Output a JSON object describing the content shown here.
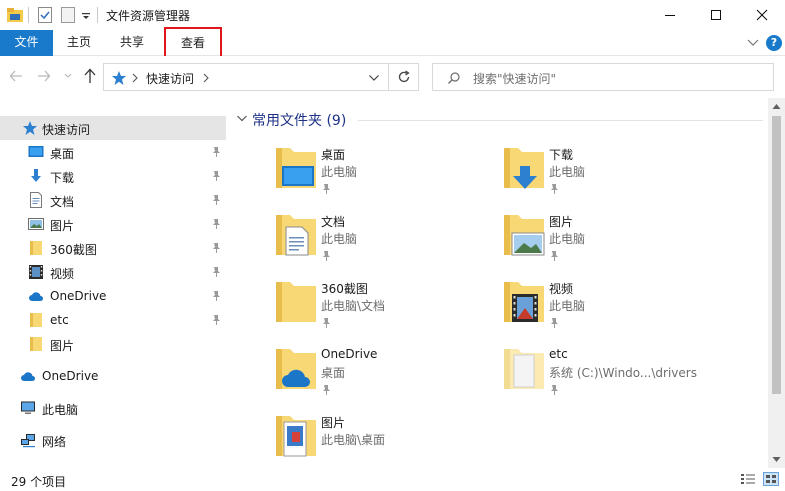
{
  "window": {
    "title": "文件资源管理器",
    "minimize_icon": "minimize-icon",
    "maximize_icon": "maximize-icon",
    "close_icon": "close-icon"
  },
  "ribbon": {
    "tabs": [
      {
        "label": "文件",
        "active": true
      },
      {
        "label": "主页"
      },
      {
        "label": "共享"
      },
      {
        "label": "查看",
        "highlighted": true
      }
    ],
    "help_label": "?",
    "accent_color": "#1979ca",
    "highlight_color": "#e0161c"
  },
  "address": {
    "path_label": "快速访问",
    "search_placeholder": "搜索\"快速访问\""
  },
  "navpane": {
    "items": [
      {
        "label": "快速访问",
        "icon": "star-icon",
        "selected": true
      },
      {
        "label": "桌面",
        "icon": "desktop-icon",
        "pinned": true
      },
      {
        "label": "下载",
        "icon": "download-icon",
        "pinned": true
      },
      {
        "label": "文档",
        "icon": "document-icon",
        "pinned": true
      },
      {
        "label": "图片",
        "icon": "picture-icon",
        "pinned": true
      },
      {
        "label": "360截图",
        "icon": "folder-icon",
        "pinned": true
      },
      {
        "label": "视频",
        "icon": "video-icon",
        "pinned": true
      },
      {
        "label": "OneDrive",
        "icon": "cloud-icon",
        "pinned": true
      },
      {
        "label": "etc",
        "icon": "folder-icon",
        "pinned": true
      },
      {
        "label": "图片",
        "icon": "folder-icon"
      },
      {
        "label": "OneDrive",
        "icon": "cloud-icon"
      },
      {
        "label": "此电脑",
        "icon": "computer-icon"
      },
      {
        "label": "网络",
        "icon": "network-icon"
      }
    ]
  },
  "content": {
    "group_title": "常用文件夹 (9)",
    "folders": [
      {
        "name": "桌面",
        "location": "此电脑",
        "icon": "desktop-folder-icon"
      },
      {
        "name": "下载",
        "location": "此电脑",
        "icon": "download-folder-icon"
      },
      {
        "name": "文档",
        "location": "此电脑",
        "icon": "document-folder-icon"
      },
      {
        "name": "图片",
        "location": "此电脑",
        "icon": "picture-folder-icon"
      },
      {
        "name": "360截图",
        "location": "此电脑\\文档",
        "icon": "folder-icon"
      },
      {
        "name": "视频",
        "location": "此电脑",
        "icon": "video-folder-icon"
      },
      {
        "name": "OneDrive",
        "location": "桌面",
        "icon": "onedrive-folder-icon"
      },
      {
        "name": "etc",
        "location": "系统 (C:)\\Windo...\\drivers",
        "icon": "folder-icon"
      },
      {
        "name": "图片",
        "location": "此电脑\\桌面",
        "icon": "picture-folder-icon"
      }
    ]
  },
  "status": {
    "item_count": "29 个项目"
  }
}
